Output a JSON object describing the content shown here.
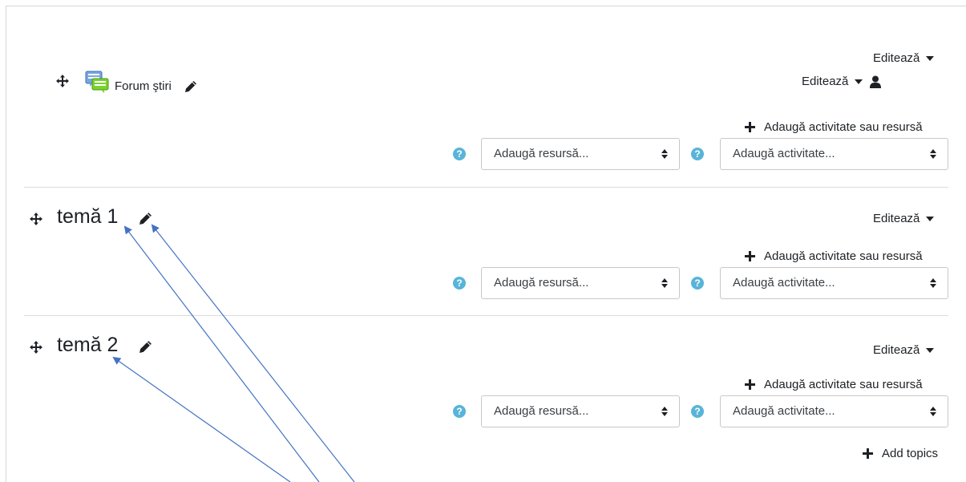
{
  "general_section": {
    "edit_section_label": "Editează",
    "forum_activity": {
      "name": "Forum ştiri",
      "edit_label": "Editează",
      "icon": "forum-icon"
    },
    "add_activity_link": "Adaugă activitate sau resursă",
    "add_resource_select": "Adaugă resursă...",
    "add_activity_select": "Adaugă activitate..."
  },
  "sections": [
    {
      "title": "temă 1",
      "edit_label": "Editează",
      "add_activity_link": "Adaugă activitate sau resursă",
      "add_resource_select": "Adaugă resursă...",
      "add_activity_select": "Adaugă activitate..."
    },
    {
      "title": "temă 2",
      "edit_label": "Editează",
      "add_activity_link": "Adaugă activitate sau resursă",
      "add_resource_select": "Adaugă resursă...",
      "add_activity_select": "Adaugă activitate..."
    }
  ],
  "add_topics_label": "Add topics",
  "help_icon_glyph": "?",
  "colors": {
    "help_icon": "#58b4d8",
    "annotation_arrow": "#4472c4",
    "text": "#1d2125"
  }
}
